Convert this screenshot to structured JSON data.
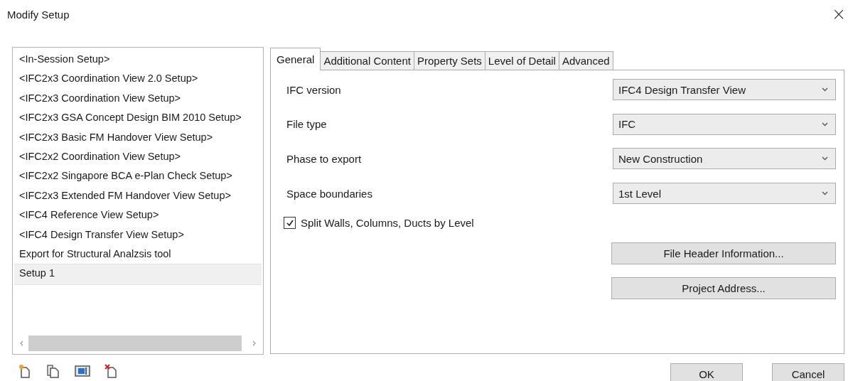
{
  "window": {
    "title": "Modify Setup",
    "close": "×"
  },
  "setups": [
    {
      "label": "<In-Session Setup>",
      "selected": false
    },
    {
      "label": "<IFC2x3 Coordination View 2.0 Setup>",
      "selected": false
    },
    {
      "label": "<IFC2x3 Coordination View Setup>",
      "selected": false
    },
    {
      "label": "<IFC2x3 GSA Concept Design BIM 2010 Setup>",
      "selected": false
    },
    {
      "label": "<IFC2x3 Basic FM Handover View Setup>",
      "selected": false
    },
    {
      "label": "<IFC2x2 Coordination View Setup>",
      "selected": false
    },
    {
      "label": "<IFC2x2 Singapore BCA e-Plan Check Setup>",
      "selected": false
    },
    {
      "label": "<IFC2x3 Extended FM Handover View Setup>",
      "selected": false
    },
    {
      "label": "<IFC4 Reference View Setup>",
      "selected": false
    },
    {
      "label": "<IFC4 Design Transfer View Setup>",
      "selected": false
    },
    {
      "label": "Export for Structural Analzsis tool",
      "selected": false
    },
    {
      "label": "Setup 1",
      "selected": true
    }
  ],
  "tabs": [
    {
      "label": "General",
      "selected": true
    },
    {
      "label": "Additional Content",
      "selected": false
    },
    {
      "label": "Property Sets",
      "selected": false
    },
    {
      "label": "Level of Detail",
      "selected": false
    },
    {
      "label": "Advanced",
      "selected": false
    }
  ],
  "fields": [
    {
      "label": "IFC version",
      "value": "IFC4 Design Transfer View"
    },
    {
      "label": "File type",
      "value": "IFC"
    },
    {
      "label": "Phase to export",
      "value": "New Construction"
    },
    {
      "label": "Space boundaries",
      "value": "1st Level"
    }
  ],
  "split_option": {
    "label": "Split Walls, Columns, Ducts by Level",
    "checked": true
  },
  "panel_buttons": [
    "File Header Information...",
    "Project Address..."
  ],
  "toolbar": [
    {
      "kind": "new"
    },
    {
      "kind": "copy"
    },
    {
      "kind": "rename"
    },
    {
      "kind": "delete"
    }
  ],
  "buttons": [
    "OK",
    "Cancel"
  ]
}
